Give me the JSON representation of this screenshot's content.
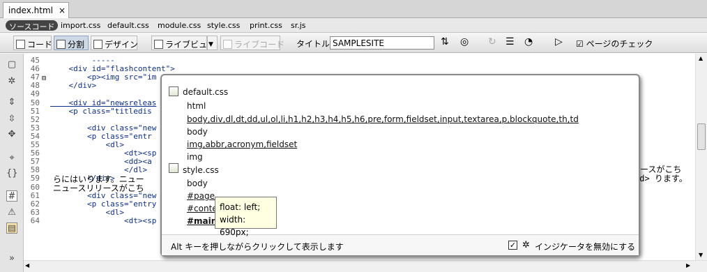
{
  "document_tab": {
    "label": "index.html",
    "close": "×"
  },
  "related_files": {
    "source_label": "ソースコード",
    "files": [
      "import.css",
      "default.css",
      "module.css",
      "style.css",
      "print.css",
      "sr.js"
    ]
  },
  "toolbar": {
    "code": "コード",
    "split": "分割",
    "design": "デザイン",
    "live_view": "ライブビュー",
    "live_code": "ライブコード",
    "title_label": "タイトル：",
    "title_value": "SAMPLESITE",
    "check_page": "ページのチェック"
  },
  "code_lines": [
    {
      "n": "45",
      "t": "         -----"
    },
    {
      "n": "46",
      "t": "    <div id=\"flashcontent\">"
    },
    {
      "n": "47",
      "t": "        <p><img src=\"im"
    },
    {
      "n": "48",
      "t": "    </div>"
    },
    {
      "n": "49",
      "t": ""
    },
    {
      "n": "50",
      "t": "    <div id=\"newsreleas"
    },
    {
      "n": "51",
      "t": "    <p class=\"titledis"
    },
    {
      "n": "52",
      "t": ""
    },
    {
      "n": "53",
      "t": "        <div class=\"new"
    },
    {
      "n": "54",
      "t": "        <p class=\"entr"
    },
    {
      "n": "55",
      "t": "            <dl>"
    },
    {
      "n": "56",
      "t": "                <dt><sp"
    },
    {
      "n": "57",
      "t": "                <dd><a"
    },
    {
      "n": "58",
      "t": "                </dl>"
    },
    {
      "n": "59",
      "t": "        </div>"
    },
    {
      "n": "60",
      "t": ""
    },
    {
      "n": "61",
      "t": "        <div class=\"new"
    },
    {
      "n": "62",
      "t": "        <p class=\"entry"
    },
    {
      "n": "63",
      "t": "            <dl>"
    },
    {
      "n": "64",
      "t": "                <dt><sp"
    }
  ],
  "wrapped_text": {
    "line1": "らにはいります。ニュー",
    "line2": "ニュースリリースがこち",
    "right1": "ースがこち",
    "right2": "dd> ります。"
  },
  "popup": {
    "groups": [
      {
        "file": "default.css",
        "rules": [
          "html",
          "body,div,dl,dt,dd,ul,ol,li,h1,h2,h3,h4,h5,h6,pre,form,fieldset,input,textarea,p,blockquote,th,td",
          "body",
          "img,abbr,acronym,fieldset",
          "img"
        ]
      },
      {
        "file": "style.css",
        "rules": [
          "body",
          "#page",
          "#conte",
          "#main"
        ]
      }
    ],
    "tooltip": {
      "line1": "float: left;",
      "line2": "width: 690px;"
    },
    "status": "Alt キーを押しながらクリックして表示します",
    "disable_indicator": "インジケータを無効にする",
    "disable_checked": "✓"
  }
}
